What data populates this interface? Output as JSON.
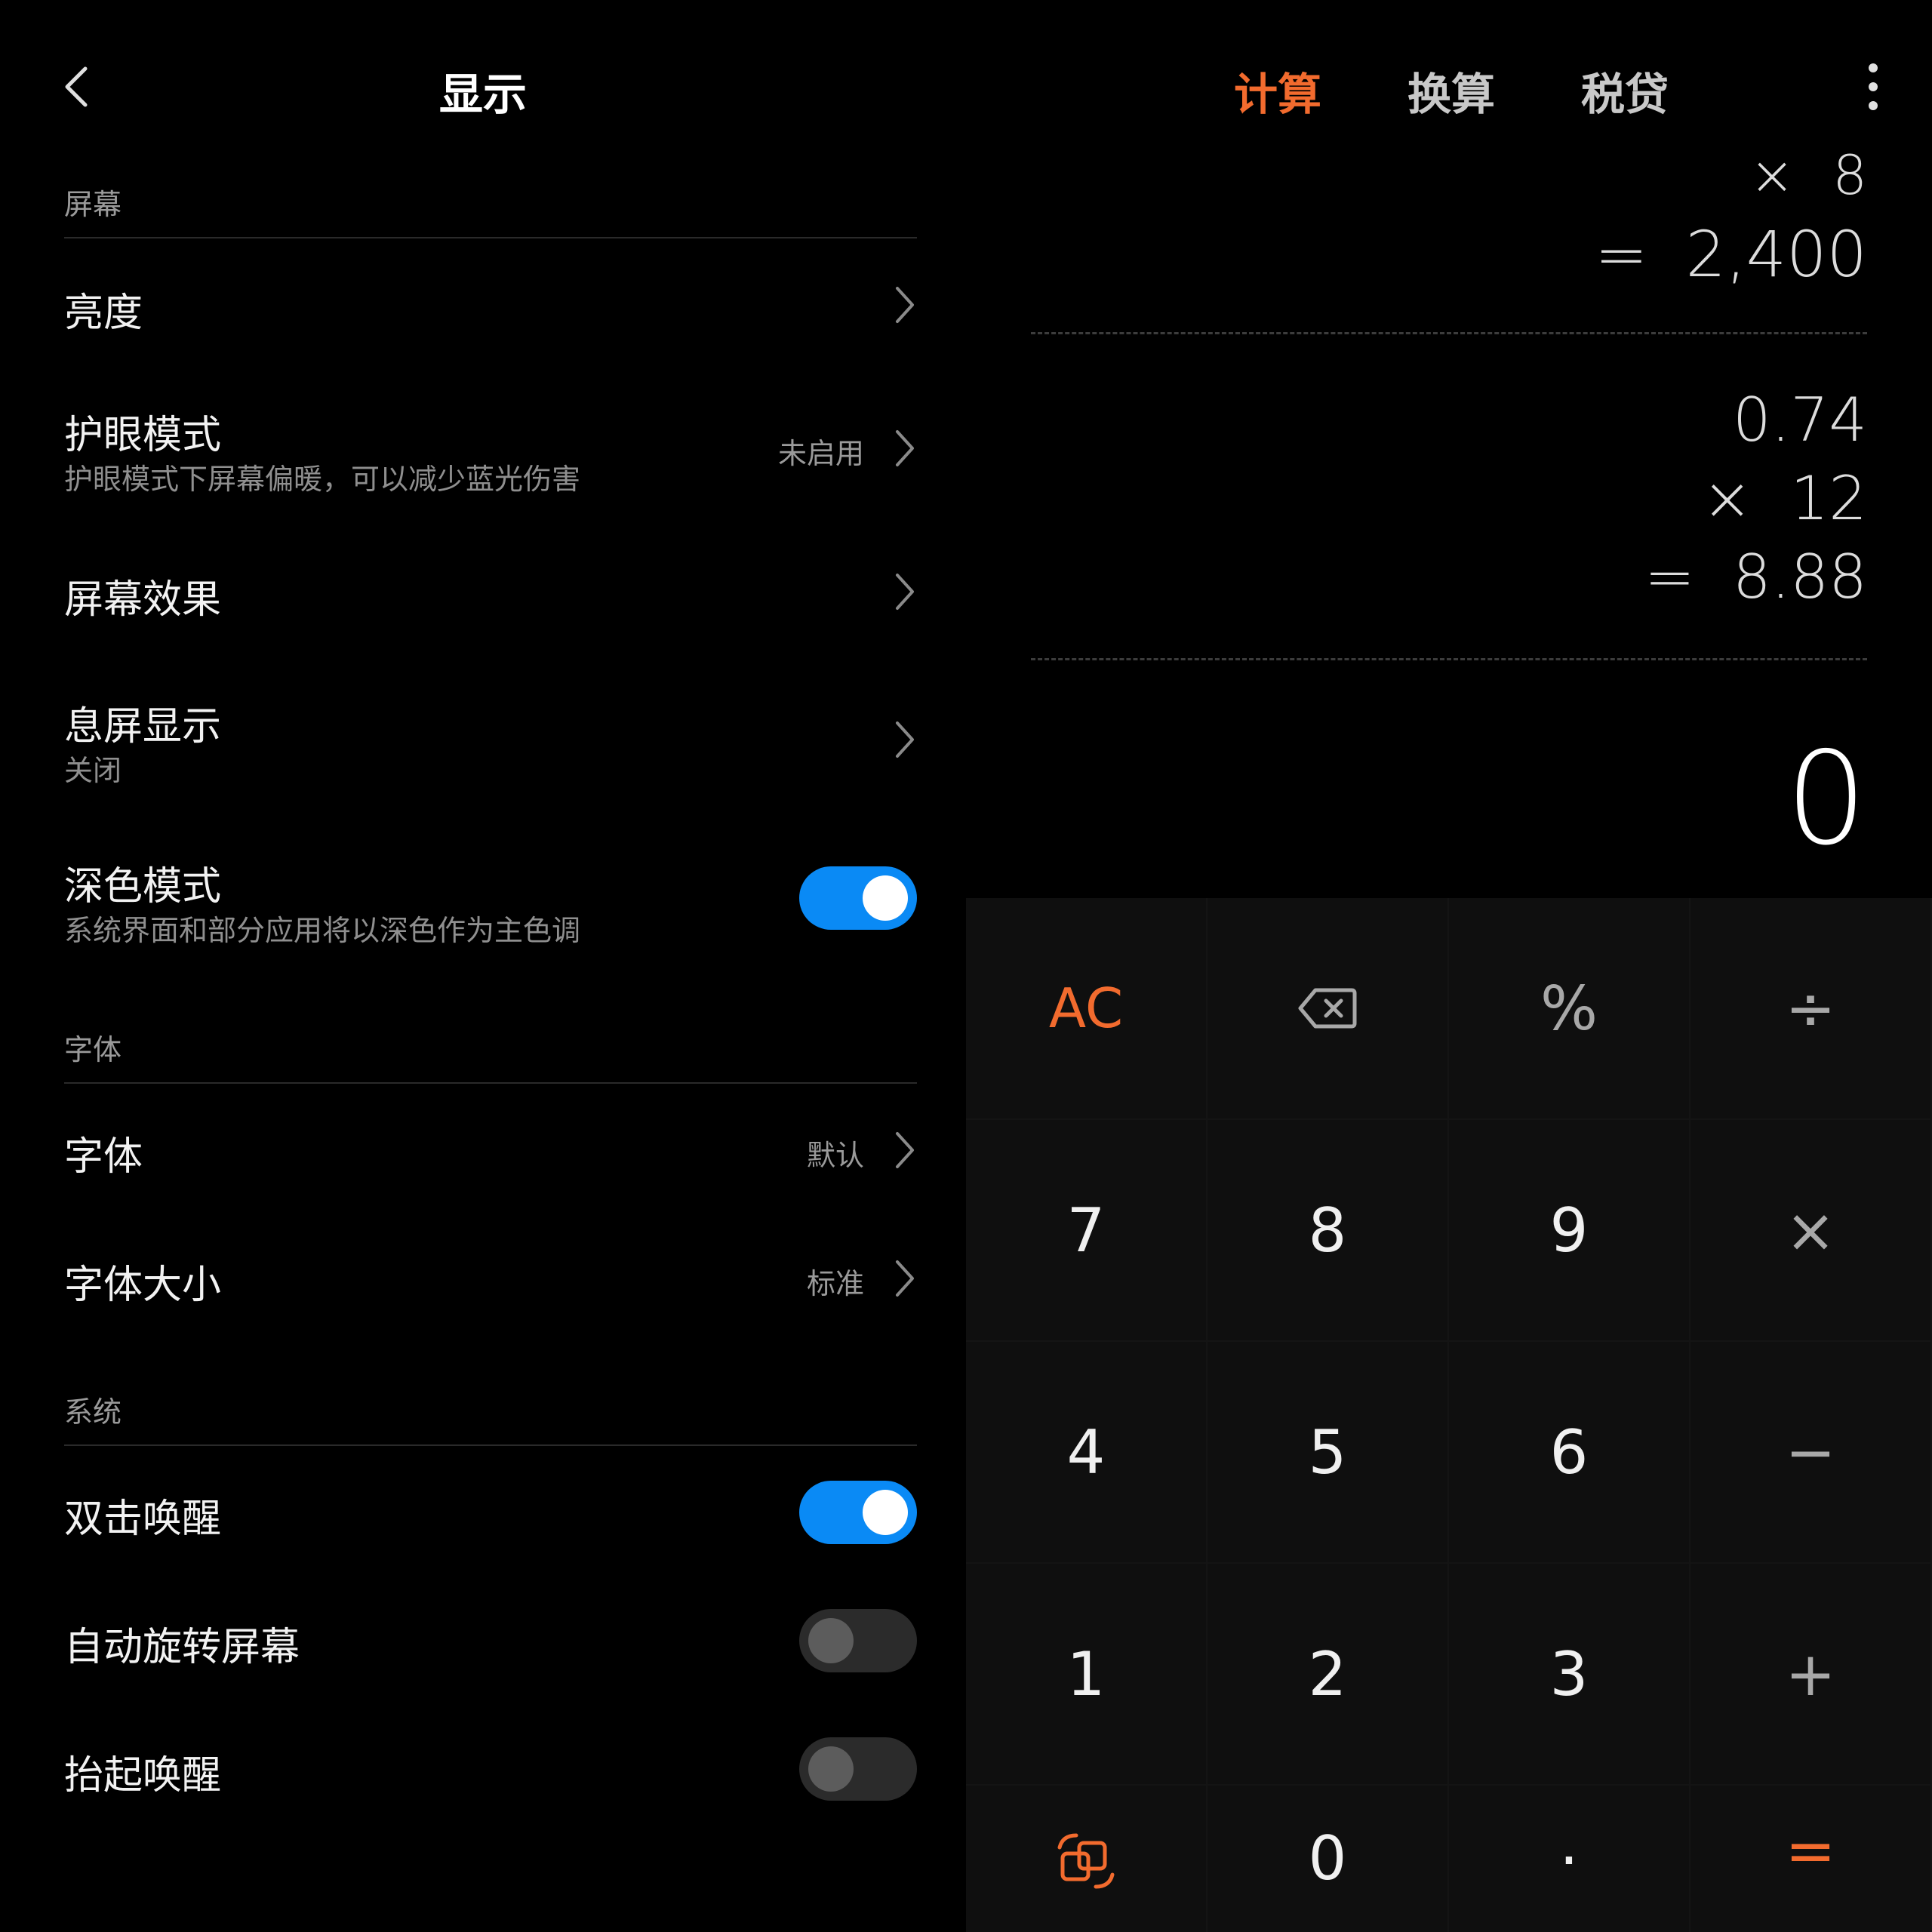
{
  "settings": {
    "title": "显示",
    "sections": [
      {
        "header": "屏幕"
      },
      {
        "header": "字体"
      },
      {
        "header": "系统"
      }
    ],
    "items": [
      {
        "title": "亮度",
        "subtitle": "",
        "value": ""
      },
      {
        "title": "护眼模式",
        "subtitle": "护眼模式下屏幕偏暖，可以减少蓝光伤害",
        "value": "未启用"
      },
      {
        "title": "屏幕效果",
        "subtitle": "",
        "value": ""
      },
      {
        "title": "息屏显示",
        "subtitle": "关闭",
        "value": ""
      },
      {
        "title": "深色模式",
        "subtitle": "系统界面和部分应用将以深色作为主色调",
        "toggle": true
      },
      {
        "title": "字体",
        "subtitle": "",
        "value": "默认"
      },
      {
        "title": "字体大小",
        "subtitle": "",
        "value": "标准"
      },
      {
        "title": "双击唤醒",
        "toggle": true
      },
      {
        "title": "自动旋转屏幕",
        "toggle": false
      },
      {
        "title": "抬起唤醒",
        "toggle": false
      }
    ]
  },
  "calculator": {
    "tabs": [
      "计算",
      "换算",
      "税贷"
    ],
    "active_tab": "计算",
    "history": [
      {
        "op": "×",
        "value": "8"
      },
      {
        "op": "=",
        "value": "2,400"
      },
      {
        "op": "",
        "value": "0.74"
      },
      {
        "op": "×",
        "value": "12"
      },
      {
        "op": "=",
        "value": "8.88"
      }
    ],
    "display": "0",
    "keys": {
      "ac": "AC",
      "percent": "%",
      "divide": "÷",
      "seven": "7",
      "eight": "8",
      "nine": "9",
      "multiply": "×",
      "four": "4",
      "five": "5",
      "six": "6",
      "minus": "−",
      "one": "1",
      "two": "2",
      "three": "3",
      "plus": "+",
      "zero": "0",
      "dot": ".",
      "equals": "="
    }
  },
  "colors": {
    "accent_orange": "#f26b2e",
    "toggle_on": "#0a8af5",
    "background": "#000000"
  }
}
